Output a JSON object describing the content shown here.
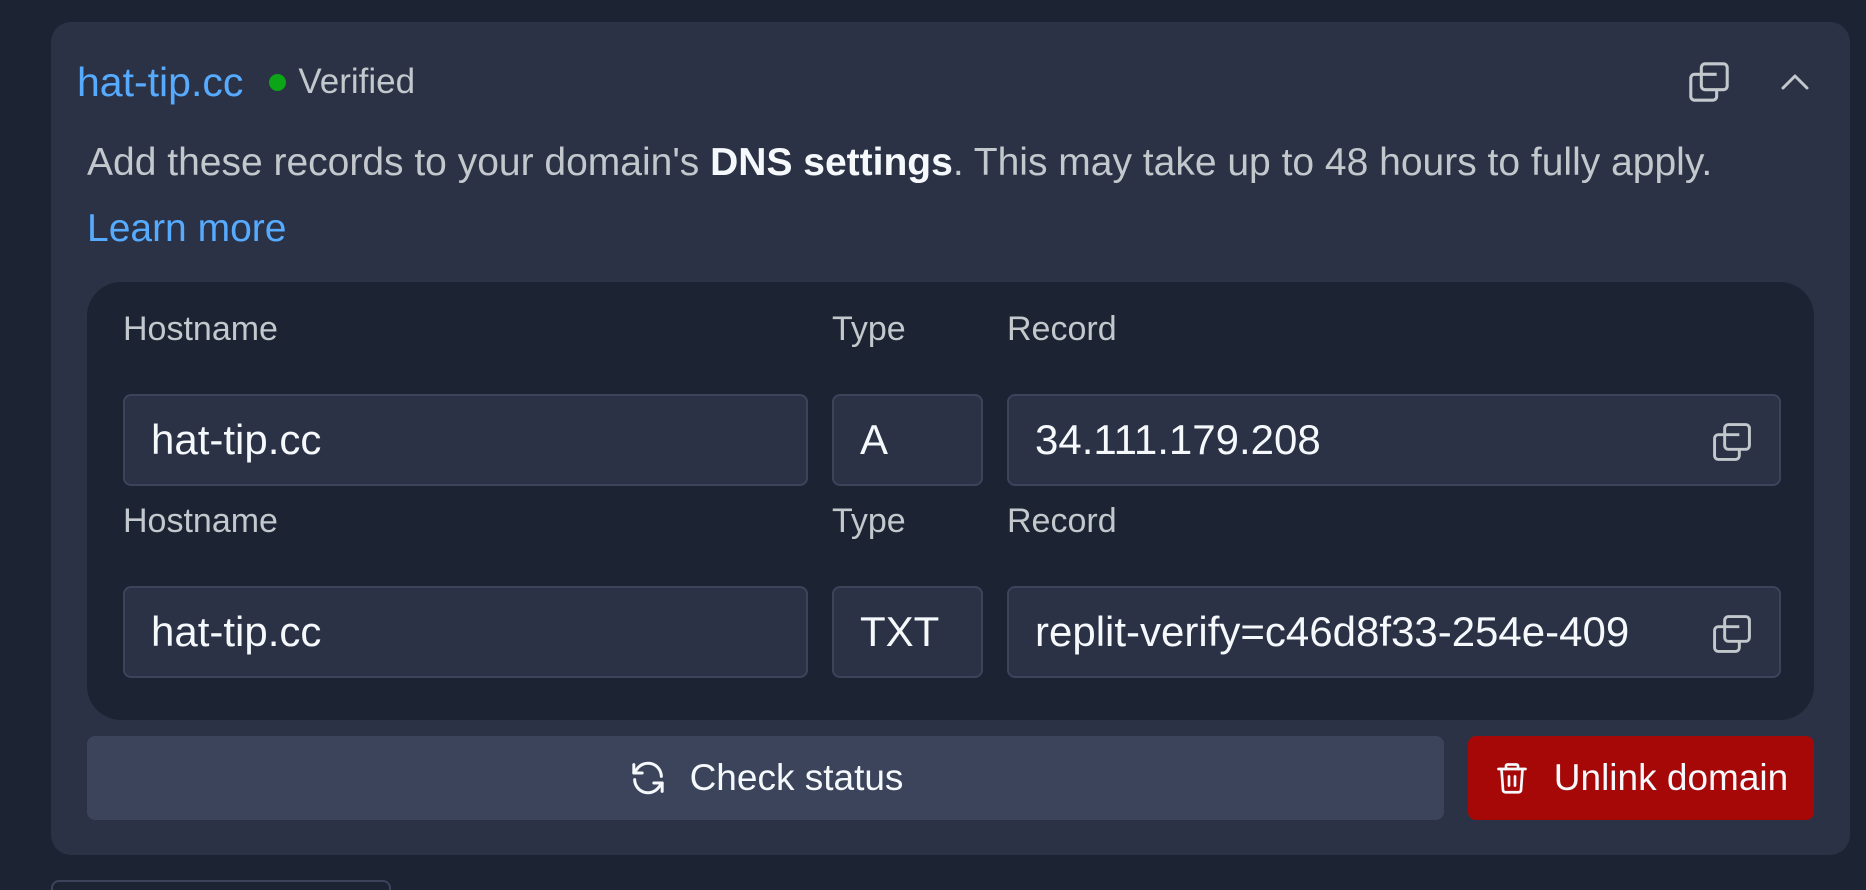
{
  "domain": {
    "name": "hat-tip.cc",
    "status": "Verified",
    "status_color": "#0ba517"
  },
  "description": {
    "prefix": "Add these records to your domain's ",
    "bold": "DNS settings",
    "suffix": ". This may take up to 48 hours to fully apply. ",
    "link": "Learn more"
  },
  "records": [
    {
      "hostname_label": "Hostname",
      "type_label": "Type",
      "record_label": "Record",
      "hostname": "hat-tip.cc",
      "type": "A",
      "record": "34.111.179.208"
    },
    {
      "hostname_label": "Hostname",
      "type_label": "Type",
      "record_label": "Record",
      "hostname": "hat-tip.cc",
      "type": "TXT",
      "record": "replit-verify=c46d8f33-254e-409"
    }
  ],
  "buttons": {
    "check_status": "Check status",
    "unlink_domain": "Unlink domain"
  },
  "icons": {
    "copy": "copy-icon",
    "collapse": "chevron-up-icon",
    "refresh": "refresh-icon",
    "trash": "trash-icon"
  },
  "colors": {
    "accent": "#57abff",
    "danger": "#a60808",
    "background": "#1c2333",
    "surface": "#2b3245"
  }
}
